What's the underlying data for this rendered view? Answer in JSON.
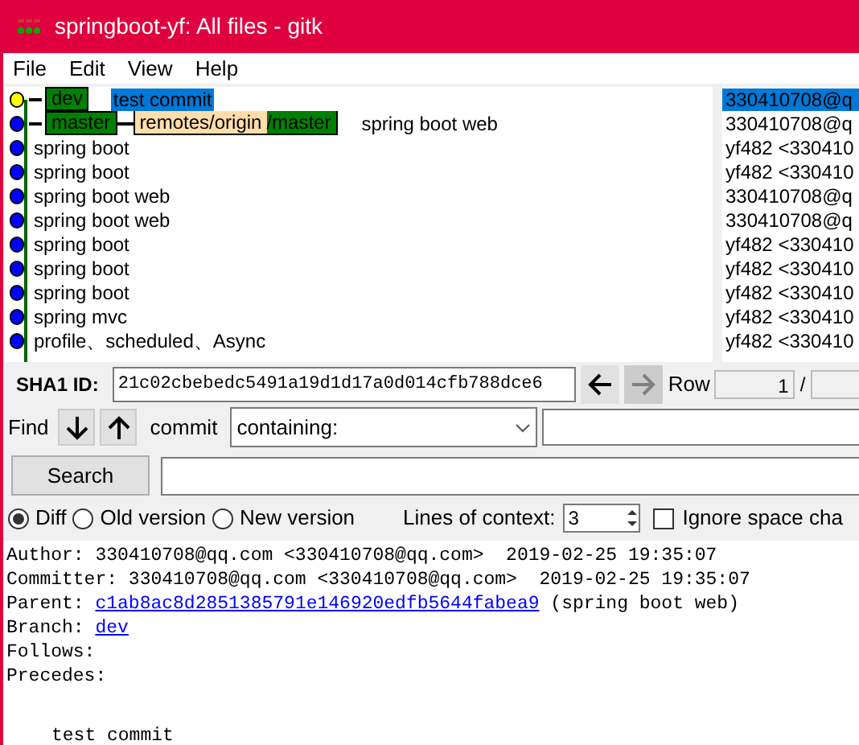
{
  "window": {
    "title": "springboot-yf: All files - gitk"
  },
  "menu": [
    "File",
    "Edit",
    "View",
    "Help"
  ],
  "commits": [
    {
      "message": "test commit",
      "author": "330410708@q",
      "selected": true,
      "head": true,
      "refs": [
        {
          "kind": "local",
          "label": "dev"
        }
      ]
    },
    {
      "message": "spring boot web",
      "author": "330410708@q",
      "selected": false,
      "head": false,
      "refs": [
        {
          "kind": "local",
          "label": "master"
        },
        {
          "kind": "remote",
          "remote": "remotes/origin",
          "label": "/master"
        }
      ]
    },
    {
      "message": "spring boot",
      "author": "yf482 <330410",
      "selected": false,
      "head": false
    },
    {
      "message": "spring boot",
      "author": "yf482 <330410",
      "selected": false,
      "head": false
    },
    {
      "message": "spring boot web",
      "author": "330410708@q",
      "selected": false,
      "head": false
    },
    {
      "message": "spring boot web",
      "author": "330410708@q",
      "selected": false,
      "head": false
    },
    {
      "message": "spring boot",
      "author": "yf482 <330410",
      "selected": false,
      "head": false
    },
    {
      "message": "spring boot",
      "author": "yf482 <330410",
      "selected": false,
      "head": false
    },
    {
      "message": "spring boot",
      "author": "yf482 <330410",
      "selected": false,
      "head": false
    },
    {
      "message": "spring mvc",
      "author": "yf482 <330410",
      "selected": false,
      "head": false
    },
    {
      "message": "profile、scheduled、Async",
      "author": "yf482 <330410",
      "selected": false,
      "head": false
    }
  ],
  "sha": {
    "label": "SHA1 ID:",
    "value": "21c02cbebedc5491a19d1d17a0d014cfb788dce6",
    "row_label": "Row",
    "row_value": "1",
    "row_sep": "/"
  },
  "find": {
    "label": "Find",
    "type_label": "commit",
    "mode": "containing:"
  },
  "search_button": "Search",
  "view_modes": [
    {
      "label": "Diff",
      "selected": true
    },
    {
      "label": "Old version",
      "selected": false
    },
    {
      "label": "New version",
      "selected": false
    }
  ],
  "context": {
    "label": "Lines of context:",
    "value": "3"
  },
  "ignore_space": {
    "label": "Ignore space cha",
    "checked": false
  },
  "details": [
    {
      "text": "Author: 330410708@qq.com <330410708@qq.com>  2019-02-25 19:35:07"
    },
    {
      "text": "Committer: 330410708@qq.com <330410708@qq.com>  2019-02-25 19:35:07"
    },
    {
      "text": "Parent: ",
      "link": "c1ab8ac8d2851385791e146920edfb5644fabea9",
      "after": " (spring boot web)"
    },
    {
      "text": "Branch: ",
      "link": "dev"
    },
    {
      "text": "Follows:"
    },
    {
      "text": "Precedes:"
    }
  ],
  "message": "test commit"
}
